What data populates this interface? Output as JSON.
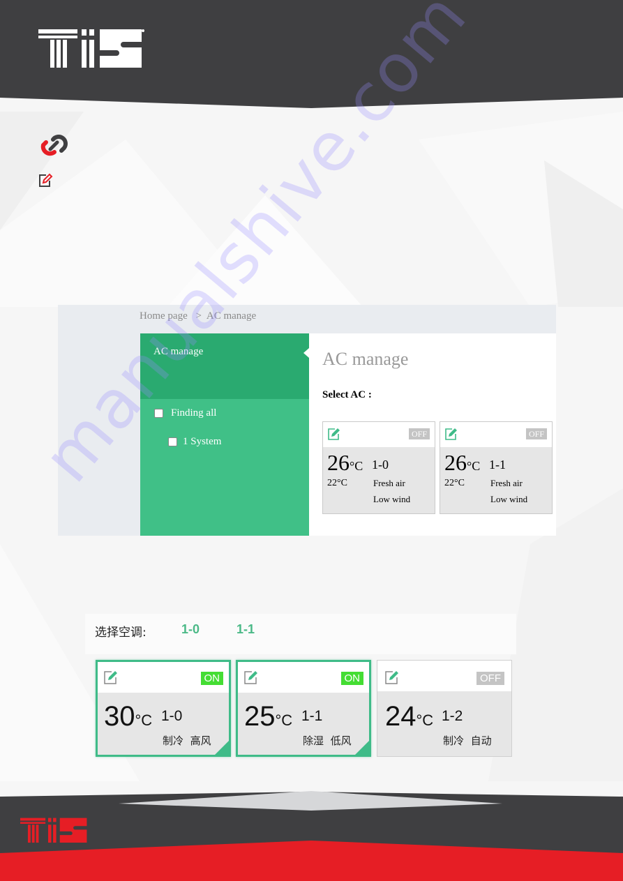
{
  "brand": {
    "logo_text": "TIS",
    "registered_mark": "®",
    "colors": {
      "header_dark": "#3f3f41",
      "brand_red": "#e61e25",
      "sidebar_green_dark": "#2aaa70",
      "sidebar_green": "#40c087",
      "on_badge": "#44dd33",
      "off_badge": "#c4c4c4"
    }
  },
  "page_icons": {
    "link_icon": "link-icon",
    "edit_icon": "edit-icon"
  },
  "ac_manage_screen": {
    "breadcrumb": {
      "home": "Home page",
      "separator": ">",
      "current": "AC manage"
    },
    "sidebar": {
      "title": "AC manage",
      "items": [
        {
          "label": "Finding all",
          "checked": false
        },
        {
          "label": "1 System",
          "checked": false
        }
      ]
    },
    "main": {
      "title": "AC manage",
      "select_label": "Select AC :",
      "cards": [
        {
          "status": "OFF",
          "set_temp": "26",
          "unit": "°C",
          "id": "1-0",
          "room_temp": "22°C",
          "mode": "Fresh air",
          "wind": "Low wind"
        },
        {
          "status": "OFF",
          "set_temp": "26",
          "unit": "°C",
          "id": "1-1",
          "room_temp": "22°C",
          "mode": "Fresh air",
          "wind": "Low wind"
        }
      ]
    }
  },
  "ac_select_screen": {
    "label": "选择空调:",
    "tabs": [
      "1-0",
      "1-1"
    ],
    "cards": [
      {
        "status": "ON",
        "temp": "30",
        "unit": "°C",
        "id": "1-0",
        "mode": "制冷",
        "wind": "高风",
        "selected": true
      },
      {
        "status": "ON",
        "temp": "25",
        "unit": "°C",
        "id": "1-1",
        "mode": "除湿",
        "wind": "低风",
        "selected": true
      },
      {
        "status": "OFF",
        "temp": "24",
        "unit": "°C",
        "id": "1-2",
        "mode": "制冷",
        "wind": "自动",
        "selected": false
      }
    ]
  },
  "watermark": "manualshive.com"
}
